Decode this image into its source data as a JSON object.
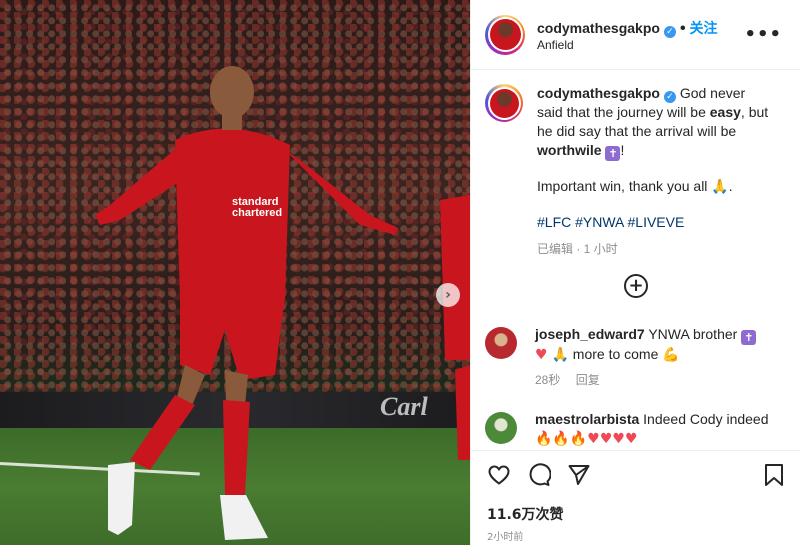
{
  "post": {
    "username": "codymathesgakpo",
    "follow_label": "关注",
    "location": "Anfield",
    "more_label": "•••"
  },
  "media": {
    "hoarding_text": "Carl",
    "next_arrow": "›"
  },
  "caption": {
    "username": "codymathesgakpo",
    "text_part1": "God never said that the journey will be ",
    "text_bold1": "easy",
    "text_part2": ", but he did say that the arrival will be ",
    "text_bold2": "worthwile",
    "text_part3": "!",
    "line2": "Important win, thank you all",
    "hashtags": "#LFC #YNWA #LIVEVE",
    "edited": "已编辑 · 1 小时"
  },
  "comments": [
    {
      "username": "joseph_edward7",
      "text1": "YNWA brother",
      "text2": "more to come",
      "age": "28秒",
      "reply_label": "回复"
    },
    {
      "username": "maestrolarbista",
      "text": "Indeed Cody indeed"
    }
  ],
  "stats": {
    "likes": "11.6万次赞",
    "posted": "2小时前"
  },
  "icons": {
    "verified": "verified-badge-icon",
    "cross": "latin-cross-emoji",
    "pray": "folded-hands-emoji",
    "heart": "red-heart-emoji",
    "fire": "fire-emoji",
    "muscle": "flexed-biceps-emoji",
    "load_more": "plus-circle-icon",
    "like": "heart-outline-icon",
    "comment": "comment-icon",
    "share": "paper-plane-icon",
    "save": "bookmark-icon"
  },
  "colors": {
    "link_blue": "#0095f6",
    "hashtag_blue": "#00376b",
    "muted": "#8e8e8e",
    "liverpool_red": "#c8151e"
  }
}
